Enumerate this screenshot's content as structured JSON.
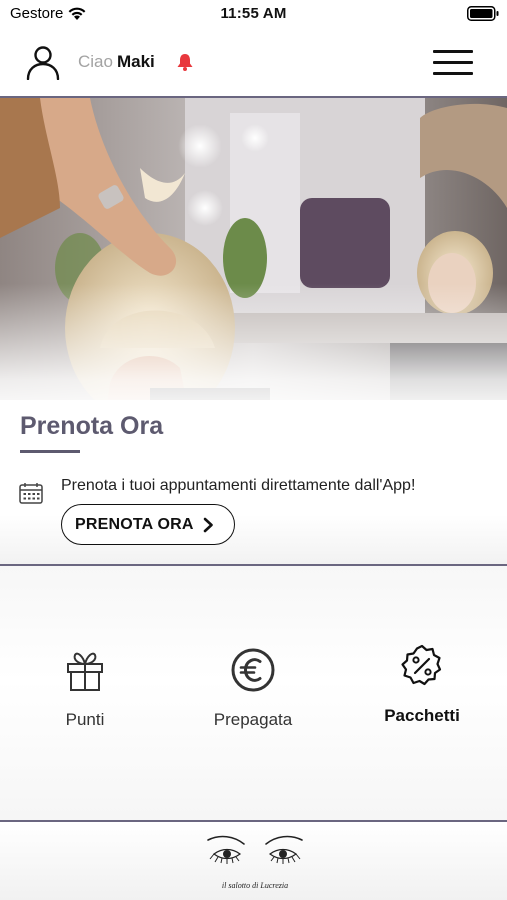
{
  "status_bar": {
    "carrier": "Gestore",
    "time": "11:55 AM"
  },
  "header": {
    "greeting_prefix": "Ciao",
    "user_name": "Maki",
    "bell_color": "#e8383d"
  },
  "booking": {
    "title": "Prenota Ora",
    "description": "Prenota i tuoi appuntamenti direttamente dall'App!",
    "button_label": "PRENOTA ORA"
  },
  "features": [
    {
      "label": "Punti",
      "icon": "gift-icon"
    },
    {
      "label": "Prepagata",
      "icon": "euro-icon"
    },
    {
      "label": "Pacchetti",
      "icon": "discount-badge-icon"
    }
  ],
  "footer": {
    "logo_text": "il salotto di Lucrezia"
  },
  "colors": {
    "accent": "#5d5a6f",
    "divider": "#6a6680",
    "alert": "#e8383d"
  }
}
